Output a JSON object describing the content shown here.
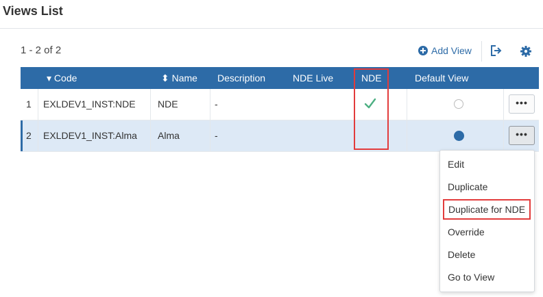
{
  "page": {
    "title": "Views List"
  },
  "list": {
    "count_text": "1 - 2 of 2"
  },
  "toolbar": {
    "add_view_label": "Add View",
    "export_icon": "export-icon",
    "settings_icon": "gear-icon"
  },
  "table": {
    "headers": {
      "code": "Code",
      "code_sort": "▾",
      "name": "Name",
      "name_sort": "⬍",
      "description": "Description",
      "nde_live": "NDE Live",
      "nde": "NDE",
      "default_view": "Default View"
    },
    "rows": [
      {
        "index": "1",
        "code": "EXLDEV1_INST:NDE",
        "name": "NDE",
        "description": "-",
        "nde": true,
        "default_view": false,
        "actions_label": "•••"
      },
      {
        "index": "2",
        "code": "EXLDEV1_INST:Alma",
        "name": "Alma",
        "description": "-",
        "nde": false,
        "default_view": true,
        "actions_label": "•••"
      }
    ]
  },
  "actions_menu": {
    "items": [
      "Edit",
      "Duplicate",
      "Duplicate for NDE",
      "Override",
      "Delete",
      "Go to View"
    ]
  },
  "colors": {
    "header_bg": "#2d6ba7",
    "check": "#4caf82",
    "highlight": "#e23b3b",
    "selected_row": "#dde9f6"
  }
}
